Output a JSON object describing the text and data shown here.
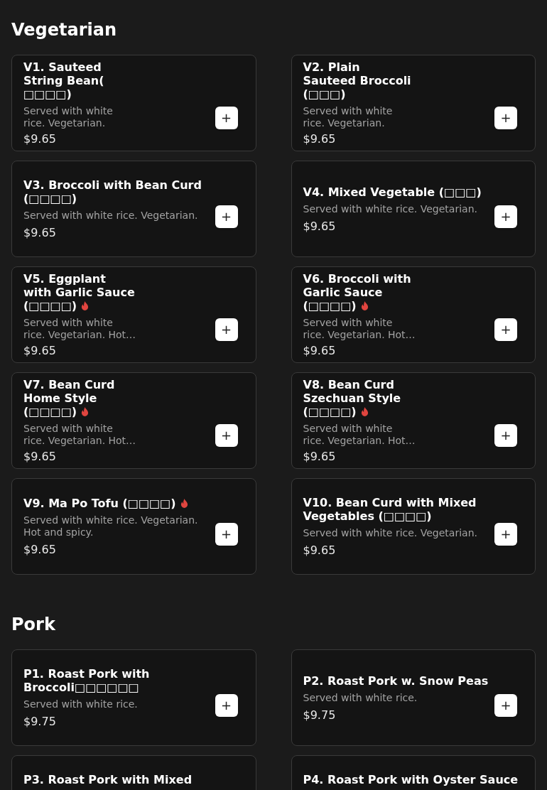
{
  "sections": [
    {
      "title": "Vegetarian",
      "items": [
        {
          "kind": "narrow",
          "name": "V1. Sauteed String Bean( □□□□)",
          "description": "Served with white rice. Vegetarian.",
          "price": "$9.65",
          "spicy": false,
          "add": "+"
        },
        {
          "kind": "narrow",
          "name": "V2. Plain Sauteed Broccoli (□□□)",
          "description": "Served with white rice. Vegetarian.",
          "price": "$9.65",
          "spicy": false,
          "add": "+"
        },
        {
          "kind": "wide",
          "name": "V3. Broccoli with Bean Curd (□□□□)",
          "description": "Served with white rice. Vegetarian.",
          "price": "$9.65",
          "spicy": false,
          "add": "+"
        },
        {
          "kind": "wide",
          "name": "V4. Mixed Vegetable (□□□)",
          "description": "Served with white rice. Vegetarian.",
          "price": "$9.65",
          "spicy": false,
          "add": "+"
        },
        {
          "kind": "narrow",
          "name": "V5. Eggplant with Garlic Sauce (□□□□)",
          "description": "Served with white rice. Vegetarian. Hot…",
          "price": "$9.65",
          "spicy": true,
          "add": "+"
        },
        {
          "kind": "narrow",
          "name": "V6. Broccoli with Garlic Sauce (□□□□)",
          "description": "Served with white rice. Vegetarian. Hot…",
          "price": "$9.65",
          "spicy": true,
          "add": "+"
        },
        {
          "kind": "narrow",
          "name": "V7. Bean Curd Home Style (□□□□)",
          "description": "Served with white rice. Vegetarian. Hot…",
          "price": "$9.65",
          "spicy": true,
          "add": "+"
        },
        {
          "kind": "narrow",
          "name": "V8. Bean Curd Szechuan Style (□□□□)",
          "description": "Served with white rice. Vegetarian. Hot…",
          "price": "$9.65",
          "spicy": true,
          "add": "+"
        },
        {
          "kind": "wide",
          "name": "V9. Ma Po Tofu (□□□□)",
          "description": "Served with white rice. Vegetarian. Hot and spicy.",
          "price": "$9.65",
          "spicy": true,
          "add": "+"
        },
        {
          "kind": "wide",
          "name": "V10. Bean Curd with Mixed Vegetables (□□□□)",
          "description": "Served with white rice. Vegetarian.",
          "price": "$9.65",
          "spicy": false,
          "add": "+"
        }
      ]
    },
    {
      "title": "Pork",
      "items": [
        {
          "kind": "wide",
          "name": "P1. Roast Pork with Broccoli□□□□□□",
          "description": "Served with white rice.",
          "price": "$9.75",
          "spicy": false,
          "add": "+"
        },
        {
          "kind": "wide",
          "name": "P2. Roast Pork w. Snow Peas",
          "description": "Served with white rice.",
          "price": "$9.75",
          "spicy": false,
          "add": "+"
        },
        {
          "kind": "wide",
          "name": "P3. Roast Pork with Mixed",
          "spicy": false
        },
        {
          "kind": "wide",
          "name": "P4. Roast Pork with Oyster Sauce",
          "spicy": false
        }
      ]
    }
  ]
}
